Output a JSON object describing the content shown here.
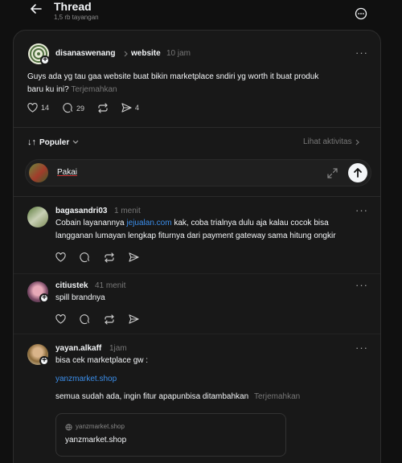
{
  "header": {
    "title": "Thread",
    "views": "1,5 rb tayangan"
  },
  "post": {
    "username": "disanaswenang",
    "topic": "website",
    "time": "10 jam",
    "text_line1": "Guys ada yg tau gaa website buat bikin marketplace sndiri yg worth it buat produk",
    "text_line2": "baru ku ini?",
    "translate": "Terjemahkan",
    "likes": "14",
    "comments": "29",
    "shares": "4"
  },
  "sort": {
    "label": "Populer",
    "activity": "Lihat aktivitas"
  },
  "reply_input": {
    "value": "Pakai"
  },
  "replies": [
    {
      "username": "bagasandri03",
      "time": "1 menit",
      "text_pre": "Cobain layanannya ",
      "text_link": "jejualan.com",
      "text_post": " kak, coba trialnya dulu aja kalau cocok bisa",
      "text_line2": "langganan lumayan lengkap fiturnya dari payment gateway sama hitung ongkir"
    },
    {
      "username": "citiustek",
      "time": "41 menit",
      "text": "spill brandnya"
    },
    {
      "username": "yayan.alkaff",
      "time": "1jam",
      "text1": "bisa cek marketplace gw :",
      "link": "yanzmarket.shop",
      "text2": "semua sudah ada, ingin fitur apapunbisa ditambahkan",
      "translate": "Terjemahkan",
      "preview_domain": "yanzmarket.shop",
      "preview_title": "yanzmarket.shop"
    }
  ],
  "colors": {
    "background": "#101010",
    "card": "#181818",
    "link": "#3b8eea"
  }
}
